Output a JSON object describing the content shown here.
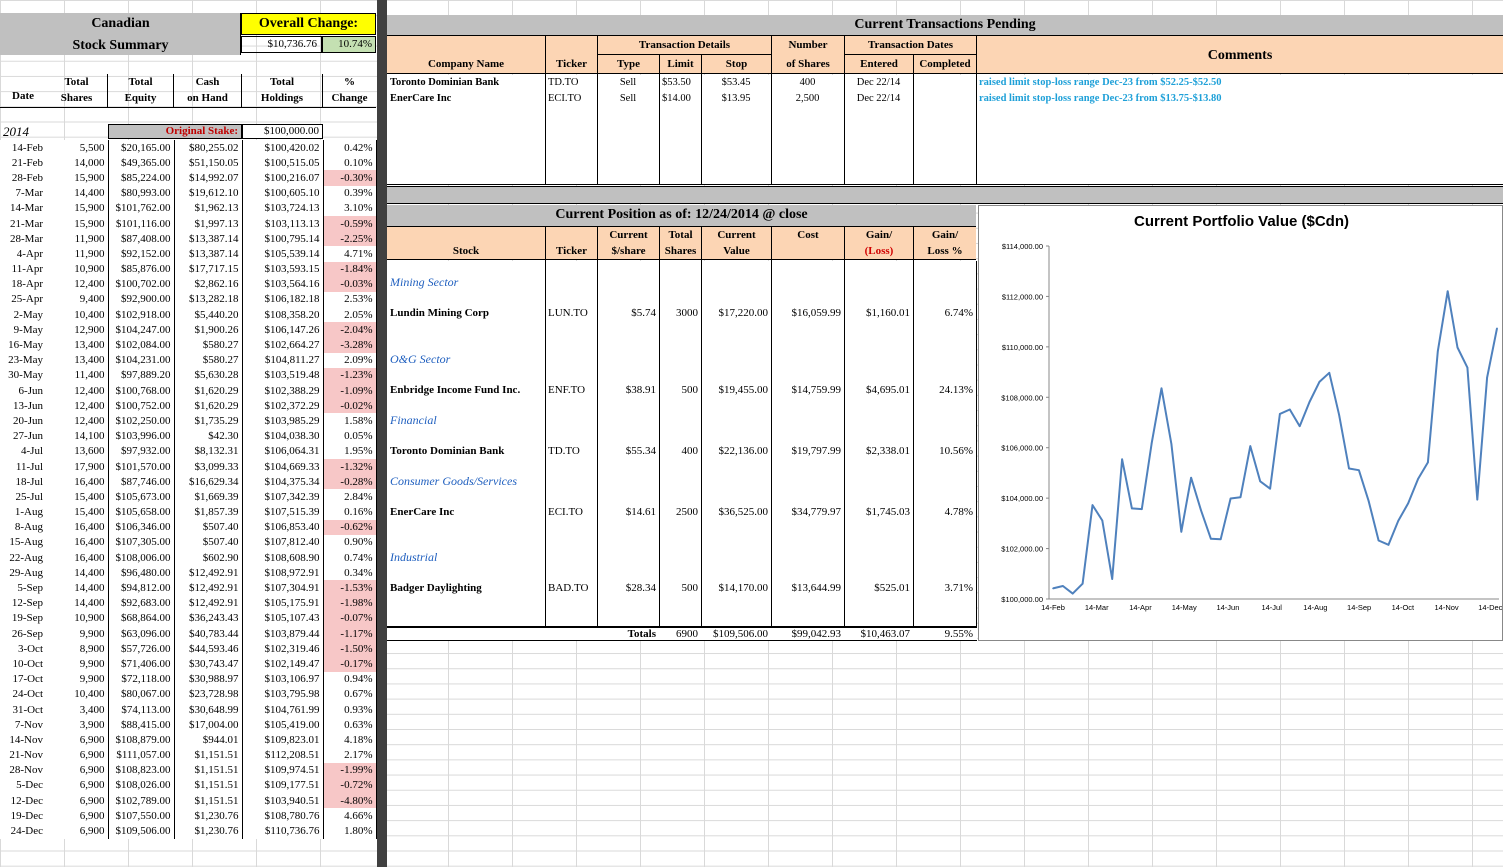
{
  "summary": {
    "title_line1": "Canadian",
    "title_line2": "Stock Summary",
    "overall_change_label": "Overall Change:",
    "overall_change_value": "$10,736.76",
    "overall_change_pct": "10.74%",
    "headers": {
      "date": "Date",
      "total_shares_1": "Total",
      "total_shares_2": "Shares",
      "total_equity_1": "Total",
      "total_equity_2": "Equity",
      "cash_1": "Cash",
      "cash_2": "on Hand",
      "holdings_1": "Total",
      "holdings_2": "Holdings",
      "pct_1": "%",
      "pct_2": "Change"
    },
    "year": "2014",
    "original_stake_label": "Original Stake:",
    "original_stake_value": "$100,000.00",
    "rows": [
      [
        "14-Feb",
        "5,500",
        "$20,165.00",
        "$80,255.02",
        "$100,420.02",
        "0.42%"
      ],
      [
        "21-Feb",
        "14,000",
        "$49,365.00",
        "$51,150.05",
        "$100,515.05",
        "0.10%"
      ],
      [
        "28-Feb",
        "15,900",
        "$85,224.00",
        "$14,992.07",
        "$100,216.07",
        "-0.30%"
      ],
      [
        "7-Mar",
        "14,400",
        "$80,993.00",
        "$19,612.10",
        "$100,605.10",
        "0.39%"
      ],
      [
        "14-Mar",
        "15,900",
        "$101,762.00",
        "$1,962.13",
        "$103,724.13",
        "3.10%"
      ],
      [
        "21-Mar",
        "15,900",
        "$101,116.00",
        "$1,997.13",
        "$103,113.13",
        "-0.59%"
      ],
      [
        "28-Mar",
        "11,900",
        "$87,408.00",
        "$13,387.14",
        "$100,795.14",
        "-2.25%"
      ],
      [
        "4-Apr",
        "11,900",
        "$92,152.00",
        "$13,387.14",
        "$105,539.14",
        "4.71%"
      ],
      [
        "11-Apr",
        "10,900",
        "$85,876.00",
        "$17,717.15",
        "$103,593.15",
        "-1.84%"
      ],
      [
        "18-Apr",
        "12,400",
        "$100,702.00",
        "$2,862.16",
        "$103,564.16",
        "-0.03%"
      ],
      [
        "25-Apr",
        "9,400",
        "$92,900.00",
        "$13,282.18",
        "$106,182.18",
        "2.53%"
      ],
      [
        "2-May",
        "10,400",
        "$102,918.00",
        "$5,440.20",
        "$108,358.20",
        "2.05%"
      ],
      [
        "9-May",
        "12,900",
        "$104,247.00",
        "$1,900.26",
        "$106,147.26",
        "-2.04%"
      ],
      [
        "16-May",
        "13,400",
        "$102,084.00",
        "$580.27",
        "$102,664.27",
        "-3.28%"
      ],
      [
        "23-May",
        "13,400",
        "$104,231.00",
        "$580.27",
        "$104,811.27",
        "2.09%"
      ],
      [
        "30-May",
        "11,400",
        "$97,889.20",
        "$5,630.28",
        "$103,519.48",
        "-1.23%"
      ],
      [
        "6-Jun",
        "12,400",
        "$100,768.00",
        "$1,620.29",
        "$102,388.29",
        "-1.09%"
      ],
      [
        "13-Jun",
        "12,400",
        "$100,752.00",
        "$1,620.29",
        "$102,372.29",
        "-0.02%"
      ],
      [
        "20-Jun",
        "12,400",
        "$102,250.00",
        "$1,735.29",
        "$103,985.29",
        "1.58%"
      ],
      [
        "27-Jun",
        "14,100",
        "$103,996.00",
        "$42.30",
        "$104,038.30",
        "0.05%"
      ],
      [
        "4-Jul",
        "13,600",
        "$97,932.00",
        "$8,132.31",
        "$106,064.31",
        "1.95%"
      ],
      [
        "11-Jul",
        "17,900",
        "$101,570.00",
        "$3,099.33",
        "$104,669.33",
        "-1.32%"
      ],
      [
        "18-Jul",
        "16,400",
        "$87,746.00",
        "$16,629.34",
        "$104,375.34",
        "-0.28%"
      ],
      [
        "25-Jul",
        "15,400",
        "$105,673.00",
        "$1,669.39",
        "$107,342.39",
        "2.84%"
      ],
      [
        "1-Aug",
        "15,400",
        "$105,658.00",
        "$1,857.39",
        "$107,515.39",
        "0.16%"
      ],
      [
        "8-Aug",
        "16,400",
        "$106,346.00",
        "$507.40",
        "$106,853.40",
        "-0.62%"
      ],
      [
        "15-Aug",
        "16,400",
        "$107,305.00",
        "$507.40",
        "$107,812.40",
        "0.90%"
      ],
      [
        "22-Aug",
        "16,400",
        "$108,006.00",
        "$602.90",
        "$108,608.90",
        "0.74%"
      ],
      [
        "29-Aug",
        "14,400",
        "$96,480.00",
        "$12,492.91",
        "$108,972.91",
        "0.34%"
      ],
      [
        "5-Sep",
        "14,400",
        "$94,812.00",
        "$12,492.91",
        "$107,304.91",
        "-1.53%"
      ],
      [
        "12-Sep",
        "14,400",
        "$92,683.00",
        "$12,492.91",
        "$105,175.91",
        "-1.98%"
      ],
      [
        "19-Sep",
        "10,900",
        "$68,864.00",
        "$36,243.43",
        "$105,107.43",
        "-0.07%"
      ],
      [
        "26-Sep",
        "9,900",
        "$63,096.00",
        "$40,783.44",
        "$103,879.44",
        "-1.17%"
      ],
      [
        "3-Oct",
        "8,900",
        "$57,726.00",
        "$44,593.46",
        "$102,319.46",
        "-1.50%"
      ],
      [
        "10-Oct",
        "9,900",
        "$71,406.00",
        "$30,743.47",
        "$102,149.47",
        "-0.17%"
      ],
      [
        "17-Oct",
        "9,900",
        "$72,118.00",
        "$30,988.97",
        "$103,106.97",
        "0.94%"
      ],
      [
        "24-Oct",
        "10,400",
        "$80,067.00",
        "$23,728.98",
        "$103,795.98",
        "0.67%"
      ],
      [
        "31-Oct",
        "3,400",
        "$74,113.00",
        "$30,648.99",
        "$104,761.99",
        "0.93%"
      ],
      [
        "7-Nov",
        "3,900",
        "$88,415.00",
        "$17,004.00",
        "$105,419.00",
        "0.63%"
      ],
      [
        "14-Nov",
        "6,900",
        "$108,879.00",
        "$944.01",
        "$109,823.01",
        "4.18%"
      ],
      [
        "21-Nov",
        "6,900",
        "$111,057.00",
        "$1,151.51",
        "$112,208.51",
        "2.17%"
      ],
      [
        "28-Nov",
        "6,900",
        "$108,823.00",
        "$1,151.51",
        "$109,974.51",
        "-1.99%"
      ],
      [
        "5-Dec",
        "6,900",
        "$108,026.00",
        "$1,151.51",
        "$109,177.51",
        "-0.72%"
      ],
      [
        "12-Dec",
        "6,900",
        "$102,789.00",
        "$1,151.51",
        "$103,940.51",
        "-4.80%"
      ],
      [
        "19-Dec",
        "6,900",
        "$107,550.00",
        "$1,230.76",
        "$108,780.76",
        "4.66%"
      ],
      [
        "24-Dec",
        "6,900",
        "$109,506.00",
        "$1,230.76",
        "$110,736.76",
        "1.80%"
      ]
    ]
  },
  "pending": {
    "title": "Current Transactions Pending",
    "headers": {
      "company": "Company Name",
      "ticker": "Ticker",
      "details": "Transaction Details",
      "type": "Type",
      "limit": "Limit",
      "stop": "Stop",
      "number_1": "Number",
      "number_2": "of Shares",
      "dates": "Transaction Dates",
      "entered": "Entered",
      "completed": "Completed",
      "comments": "Comments"
    },
    "rows": [
      {
        "company": "Toronto Dominian Bank",
        "ticker": "TD.TO",
        "type": "Sell",
        "limit": "$53.50",
        "stop": "$53.45",
        "shares": "400",
        "entered": "Dec 22/14",
        "completed": "",
        "comment": "raised limit stop-loss range Dec-23 from $52.25-$52.50"
      },
      {
        "company": "EnerCare Inc",
        "ticker": "ECI.TO",
        "type": "Sell",
        "limit": "$14.00",
        "stop": "$13.95",
        "shares": "2,500",
        "entered": "Dec 22/14",
        "completed": "",
        "comment": "raised limit stop-loss range Dec-23 from $13.75-$13.80"
      }
    ]
  },
  "position": {
    "title": "Current Position as of:  12/24/2014  @ close",
    "headers": {
      "stock": "Stock",
      "ticker": "Ticker",
      "price_1": "Current",
      "price_2": "$/share",
      "shares_1": "Total",
      "shares_2": "Shares",
      "value_1": "Current",
      "value_2": "Value",
      "cost": "Cost",
      "gain_1": "Gain/",
      "gain_2": "(Loss)",
      "gainpct_1": "Gain/",
      "gainpct_2": "Loss %"
    },
    "sectors": [
      {
        "name": "Mining Sector",
        "stock": "Lundin Mining Corp",
        "ticker": "LUN.TO",
        "price": "$5.74",
        "shares": "3000",
        "value": "$17,220.00",
        "cost": "$16,059.99",
        "gain": "$1,160.01",
        "pct": "6.74%"
      },
      {
        "name": "O&G Sector",
        "stock": "Enbridge Income Fund Inc.",
        "ticker": "ENF.TO",
        "price": "$38.91",
        "shares": "500",
        "value": "$19,455.00",
        "cost": "$14,759.99",
        "gain": "$4,695.01",
        "pct": "24.13%"
      },
      {
        "name": "Financial",
        "stock": "Toronto Dominian Bank",
        "ticker": "TD.TO",
        "price": "$55.34",
        "shares": "400",
        "value": "$22,136.00",
        "cost": "$19,797.99",
        "gain": "$2,338.01",
        "pct": "10.56%"
      },
      {
        "name": "Consumer Goods/Services",
        "stock": "EnerCare Inc",
        "ticker": "ECI.TO",
        "price": "$14.61",
        "shares": "2500",
        "value": "$36,525.00",
        "cost": "$34,779.97",
        "gain": "$1,745.03",
        "pct": "4.78%"
      },
      {
        "name": "Industrial",
        "stock": "Badger Daylighting",
        "ticker": "BAD.TO",
        "price": "$28.34",
        "shares": "500",
        "value": "$14,170.00",
        "cost": "$13,644.99",
        "gain": "$525.01",
        "pct": "3.71%"
      }
    ],
    "totals": {
      "label": "Totals",
      "shares": "6900",
      "value": "$109,506.00",
      "cost": "$99,042.93",
      "gain": "$10,463.07",
      "pct": "9.55%"
    }
  },
  "chart_data": {
    "type": "line",
    "title": "Current Portfolio Value ($Cdn)",
    "ylim": [
      100000,
      114000
    ],
    "yticks": [
      "$100,000.00",
      "$102,000.00",
      "$104,000.00",
      "$106,000.00",
      "$108,000.00",
      "$110,000.00",
      "$112,000.00",
      "$114,000.00"
    ],
    "xticks": [
      "14-Feb",
      "14-Mar",
      "14-Apr",
      "14-May",
      "14-Jun",
      "14-Jul",
      "14-Aug",
      "14-Sep",
      "14-Oct",
      "14-Nov",
      "14-Dec"
    ],
    "series": [
      {
        "values": [
          100420.02,
          100515.05,
          100216.07,
          100605.1,
          103724.13,
          103113.13,
          100795.14,
          105539.14,
          103593.15,
          103564.16,
          106182.18,
          108358.2,
          106147.26,
          102664.27,
          104811.27,
          103519.48,
          102388.29,
          102372.29,
          103985.29,
          104038.3,
          106064.31,
          104669.33,
          104375.34,
          107342.39,
          107515.39,
          106853.4,
          107812.4,
          108608.9,
          108972.91,
          107304.91,
          105175.91,
          105107.43,
          103879.44,
          102319.46,
          102149.47,
          103106.97,
          103795.98,
          104761.99,
          105419.0,
          109823.01,
          112208.51,
          109974.51,
          109177.51,
          103940.51,
          108780.76,
          110736.76
        ]
      }
    ],
    "color": "#4f81bd"
  }
}
